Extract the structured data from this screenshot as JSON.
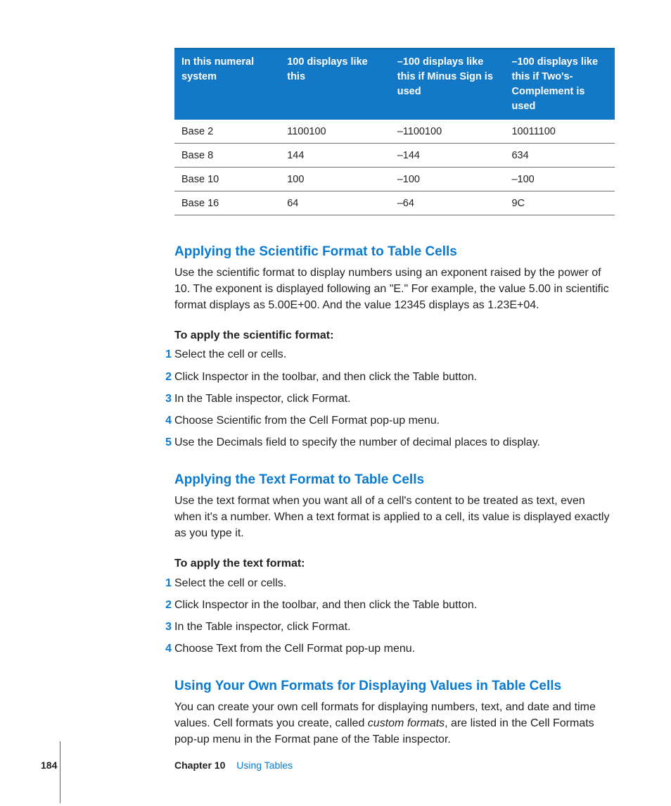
{
  "table": {
    "headers": [
      "In this numeral system",
      "100 displays like this",
      "–100 displays like this if Minus Sign is used",
      "–100 displays like this if Two's-Complement is used"
    ],
    "rows": [
      [
        "Base 2",
        "1100100",
        "–1100100",
        "10011100"
      ],
      [
        "Base 8",
        "144",
        "–144",
        "634"
      ],
      [
        "Base 10",
        "100",
        "–100",
        "–100"
      ],
      [
        "Base 16",
        "64",
        "–64",
        "9C"
      ]
    ]
  },
  "sections": {
    "sci": {
      "heading": "Applying the Scientific Format to Table Cells",
      "para": "Use the scientific format to display numbers using an exponent raised by the power of 10. The exponent is displayed following an \"E.\" For example, the value 5.00 in scientific format displays as 5.00E+00. And the value 12345 displays as 1.23E+04.",
      "lead": "To apply the scientific format:",
      "steps": [
        "Select the cell or cells.",
        "Click Inspector in the toolbar, and then click the Table button.",
        "In the Table inspector, click Format.",
        "Choose Scientific from the Cell Format pop-up menu.",
        "Use the Decimals field to specify the number of decimal places to display."
      ]
    },
    "text": {
      "heading": "Applying the Text Format to Table Cells",
      "para": "Use the text format when you want all of a cell's content to be treated as text, even when it's a number. When a text format is applied to a cell, its value is displayed exactly as you type it.",
      "lead": "To apply the text format:",
      "steps": [
        "Select the cell or cells.",
        "Click Inspector in the toolbar, and then click the Table button.",
        "In the Table inspector, click Format.",
        "Choose Text from the Cell Format pop-up menu."
      ]
    },
    "own": {
      "heading": "Using Your Own Formats for Displaying Values in Table Cells",
      "para_pre": "You can create your own cell formats for displaying numbers, text, and date and time values. Cell formats you create, called ",
      "para_em": "custom formats",
      "para_post": ", are listed in the Cell Formats pop-up menu in the Format pane of the Table inspector."
    }
  },
  "footer": {
    "page": "184",
    "chapter_label": "Chapter 10",
    "chapter_title": "Using Tables"
  }
}
